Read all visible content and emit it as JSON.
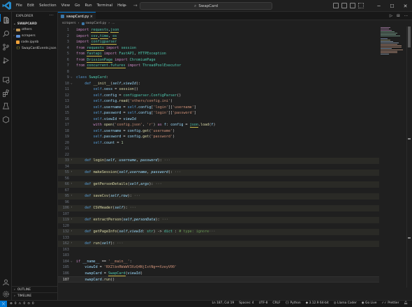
{
  "menu": [
    "File",
    "Edit",
    "Selection",
    "View",
    "Go",
    "Run",
    "Terminal",
    "Help"
  ],
  "search_text": "SwapCard",
  "sidebar": {
    "title": "EXPLORER",
    "folder": "SWAPCARD",
    "items": [
      {
        "label": "others",
        "type": "folder",
        "color": "#c09553"
      },
      {
        "label": "scrapers",
        "type": "folder",
        "color": "#5b8fd6"
      },
      {
        "label": "code.ipynb",
        "type": "file",
        "color": "#f2a33a"
      },
      {
        "label": "SwapCardEvents.json",
        "type": "file",
        "color": "#cbcb41"
      }
    ],
    "outline": "OUTLINE",
    "timeline": "TIMELINE"
  },
  "tab": {
    "label": "swapCard.py",
    "close": "×"
  },
  "breadcrumb": [
    "scrapers",
    "swapCard.py",
    "..."
  ],
  "code_lines": [
    {
      "n": "1"
    },
    {
      "n": "2"
    },
    {
      "n": "3"
    },
    {
      "n": "4"
    },
    {
      "n": "5"
    },
    {
      "n": "6"
    },
    {
      "n": "7"
    },
    {
      "n": "8"
    },
    {
      "n": "9"
    },
    {
      "n": "10"
    },
    {
      "n": "11"
    },
    {
      "n": "12"
    },
    {
      "n": "13"
    },
    {
      "n": "14"
    },
    {
      "n": "15"
    },
    {
      "n": "16"
    },
    {
      "n": "17"
    },
    {
      "n": "18"
    },
    {
      "n": "19"
    },
    {
      "n": "20"
    },
    {
      "n": "21"
    },
    {
      "n": "22"
    },
    {
      "n": "33"
    },
    {
      "n": "34"
    },
    {
      "n": "55"
    },
    {
      "n": "56"
    },
    {
      "n": "66"
    },
    {
      "n": "67"
    },
    {
      "n": "95"
    },
    {
      "n": "96"
    },
    {
      "n": "106"
    },
    {
      "n": "107"
    },
    {
      "n": "119"
    },
    {
      "n": "120"
    },
    {
      "n": "132"
    },
    {
      "n": "133"
    },
    {
      "n": "162"
    },
    {
      "n": "163"
    },
    {
      "n": "183"
    },
    {
      "n": "184"
    },
    {
      "n": "185"
    },
    {
      "n": "186"
    },
    {
      "n": "187"
    }
  ],
  "status": {
    "errors": "0",
    "warnings": "0",
    "info": "0",
    "position": "Ln 187, Col 19",
    "spaces": "Spaces: 4",
    "encoding": "UTF-8",
    "eol": "CRLF",
    "language": "Python",
    "interpreter": "3.12.9 64-bit",
    "llama": "Llama Coder",
    "golive": "Go Live",
    "prettier": "Prettier"
  },
  "colors": {
    "accent": "#0078d4",
    "editor_bg": "#1f1f1f",
    "sidebar_bg": "#181818",
    "keyword": "#c586c0",
    "function": "#dcdcaa",
    "class": "#4ec9b0",
    "string": "#ce9178"
  }
}
